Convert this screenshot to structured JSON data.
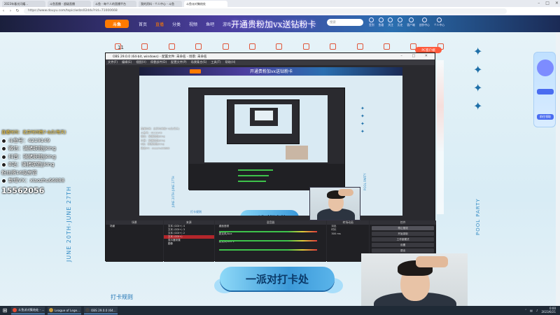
{
  "browser": {
    "tabs": [
      {
        "label": "2023年春光闪耀…"
      },
      {
        "label": "斗鱼直播 - 超级直播"
      },
      {
        "label": "斗鱼 - 每个人的直播平台"
      },
      {
        "label": "我的资料 - 个人中心 - 斗鱼"
      },
      {
        "label": "斗鱼派对集结处"
      }
    ],
    "url": "https://www.douyu.com/topic/wdzs02ddv?rid=71000668"
  },
  "site": {
    "logo": "斗鱼",
    "nav": [
      "首页",
      "直播",
      "分类",
      "视频",
      "鱼吧",
      "游戏"
    ],
    "banner": "开通贵粉加vx送钻粉卡",
    "search_placeholder": "搜索",
    "header_icons": [
      "签到",
      "鱼塘",
      "关注",
      "历史",
      "客户端",
      "创作中心",
      "个人中心"
    ],
    "day_number": "11",
    "pc_tag": "PC客户端",
    "vertical_left": "JUNE 20TH-JUNE 27TH",
    "vertical_right": "POOL PARTY",
    "rule_title": "打卡规则",
    "event_banner": "一派对打卡处",
    "side_panel_label": "前往领取"
  },
  "streamer_info": {
    "line1": "直播时间：北京时间晚7-8点(每天)",
    "line2": "斗鱼号：4219149",
    "line3": "微信：骑猪联盟jjking",
    "line4": "抖音：骑猪联盟jjking",
    "line5": "B站：骑猪联盟jjking",
    "line6": "粉丝牌16级房管",
    "line7": "新增VX：xiaozhu66888",
    "big_number": "15562056"
  },
  "obs": {
    "title": "OBS 29.0.0 (64-bit, windows) - 配置文件: 未命名 - 场景: 未命名",
    "menu": [
      "文件(F)",
      "编辑(E)",
      "视图(V)",
      "停靠部件(D)",
      "配置文件(P)",
      "场景集合(S)",
      "工具(T)",
      "帮助(H)"
    ],
    "dock_titles": [
      "场景",
      "来源",
      "混音器",
      "转场动画",
      "控件"
    ],
    "scene_name": "场景",
    "sources": [
      {
        "name": "文本 (GDI+) 4"
      },
      {
        "name": "文本 (GDI+) 3"
      },
      {
        "name": "文本 (GDI+) 2"
      },
      {
        "name": "文本 (GDI+)"
      },
      {
        "name": "显示器采集"
      },
      {
        "name": "图像"
      }
    ],
    "mixer": [
      "桌面音频",
      "麦克风/Aux",
      "麦克风/Aux 2"
    ],
    "transition": {
      "type": "淡出",
      "duration_label": "时长",
      "duration": "300 ms"
    },
    "controls": [
      "停止推流",
      "开始录制",
      "工作室模式",
      "设置",
      "退出"
    ]
  },
  "taskbar": {
    "apps": [
      {
        "label": "斗鱼派对集结处 - ...",
        "color": "#e24a33"
      },
      {
        "label": "League of Lege...",
        "color": "#c99b3a"
      },
      {
        "label": "OBS 29.0.0 (64...",
        "color": "#444444"
      }
    ],
    "time": "0:00",
    "date": "2023/6/21"
  }
}
